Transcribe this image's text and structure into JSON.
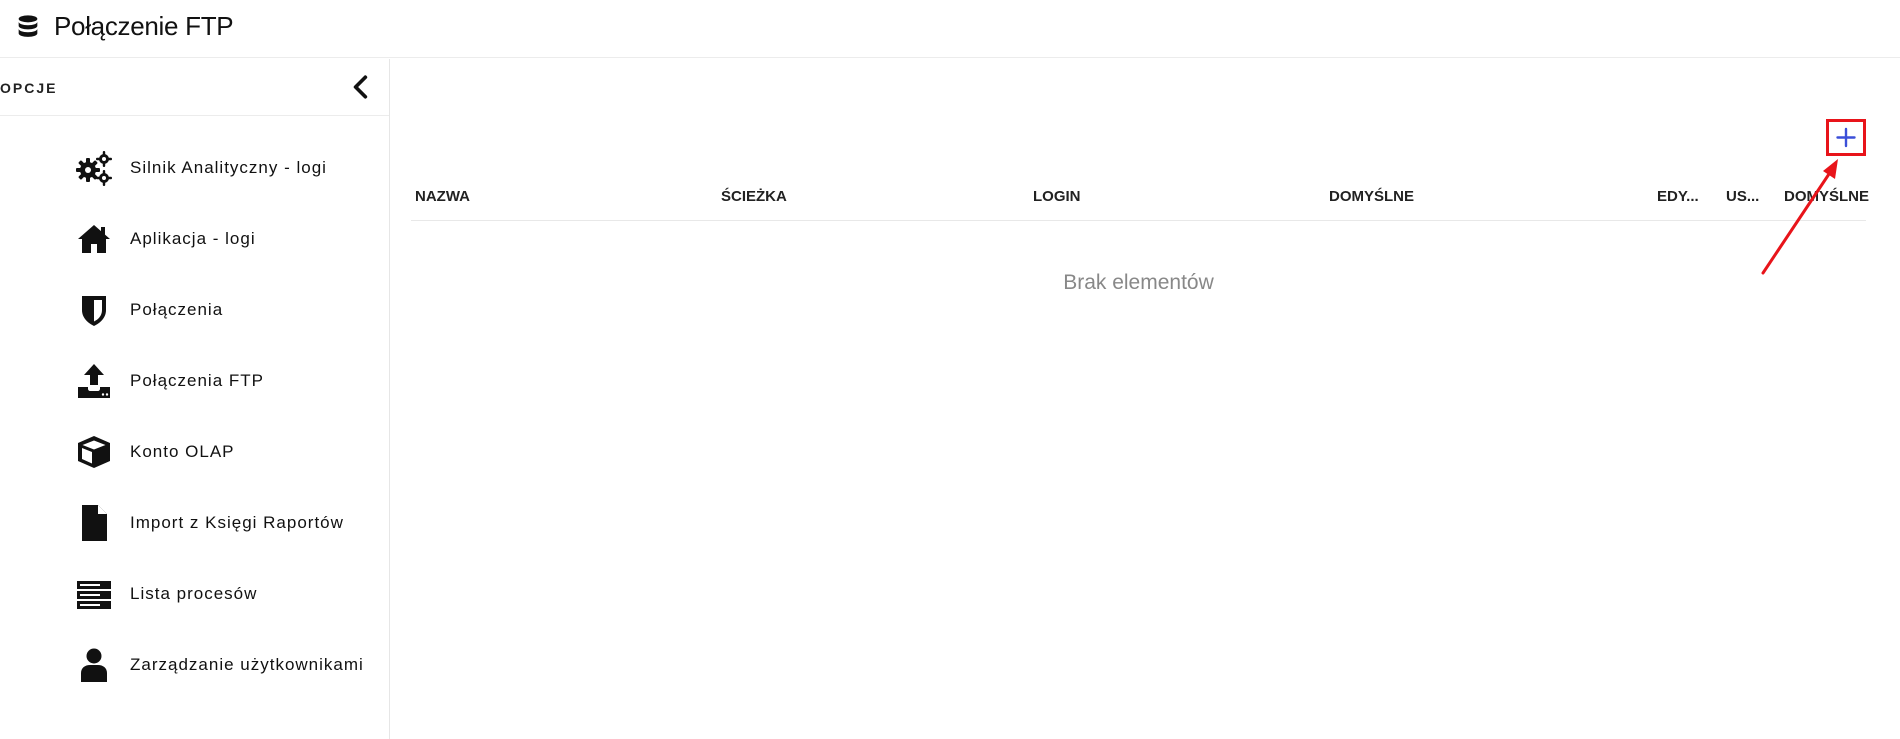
{
  "app": {
    "title": "Połączenie FTP",
    "icon": "database-icon"
  },
  "sidebar": {
    "header_label": "OPCJE",
    "collapse_icon": "chevron-left-icon",
    "items": [
      {
        "label": "Silnik Analityczny - logi",
        "icon": "gears-icon"
      },
      {
        "label": "Aplikacja - logi",
        "icon": "home-icon"
      },
      {
        "label": "Połączenia",
        "icon": "shield-icon"
      },
      {
        "label": "Połączenia FTP",
        "icon": "upload-icon"
      },
      {
        "label": "Konto OLAP",
        "icon": "cube-icon"
      },
      {
        "label": "Import z Księgi Raportów",
        "icon": "file-icon"
      },
      {
        "label": "Lista procesów",
        "icon": "server-list-icon"
      },
      {
        "label": "Zarządzanie użytkownikami",
        "icon": "user-icon"
      }
    ]
  },
  "main": {
    "add_button_icon": "plus-icon",
    "table": {
      "columns": [
        "NAZWA",
        "ŚCIEŻKA",
        "LOGIN",
        "DOMYŚLNE",
        "EDY...",
        "US...",
        "DOMYŚLNE"
      ],
      "rows": [],
      "empty_text": "Brak elementów"
    }
  },
  "colors": {
    "annotation_red": "#e8141a",
    "plus_blue": "#3b4fd8",
    "empty_text_gray": "#888888"
  }
}
